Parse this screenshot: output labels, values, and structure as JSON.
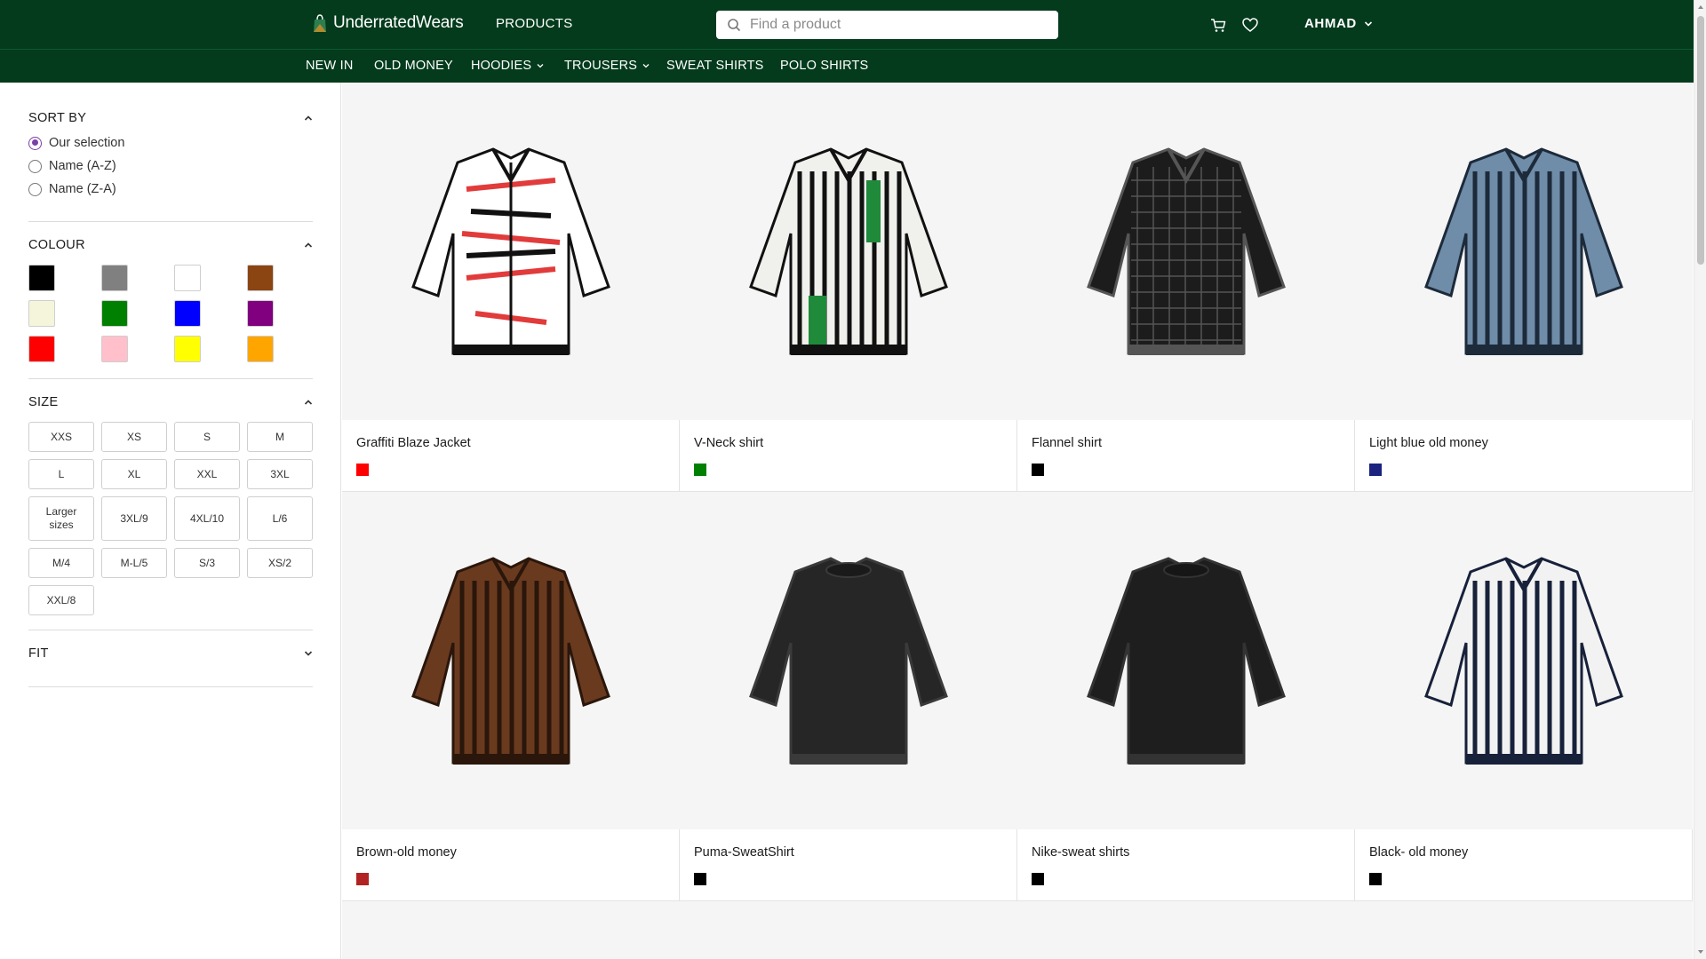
{
  "header": {
    "brand": "UnderratedWears",
    "products_label": "PRODUCTS",
    "search": {
      "placeholder": "Find a product",
      "value": ""
    },
    "user": "AHMAD",
    "icons": [
      "cart-icon",
      "heart-icon"
    ]
  },
  "categories": [
    {
      "label": "NEW IN",
      "dropdown": false
    },
    {
      "label": "OLD MONEY",
      "dropdown": false
    },
    {
      "label": "HOODIES",
      "dropdown": true
    },
    {
      "label": "TROUSERS",
      "dropdown": true
    },
    {
      "label": "SWEAT SHIRTS",
      "dropdown": false
    },
    {
      "label": "POLO SHIRTS",
      "dropdown": false
    }
  ],
  "sidebar": {
    "sort": {
      "title": "SORT BY",
      "options": [
        {
          "label": "Our selection",
          "selected": true
        },
        {
          "label": "Name (A-Z)",
          "selected": false
        },
        {
          "label": "Name (Z-A)",
          "selected": false
        }
      ]
    },
    "colour": {
      "title": "COLOUR",
      "swatches": [
        "#000000",
        "#808080",
        "#ffffff",
        "#8b4513",
        "#f5f5dc",
        "#008000",
        "#0000ff",
        "#800080",
        "#ff0000",
        "#ffc0cb",
        "#ffff00",
        "#ffa500"
      ]
    },
    "size": {
      "title": "SIZE",
      "options": [
        "XXS",
        "XS",
        "S",
        "M",
        "L",
        "XL",
        "XXL",
        "3XL",
        "Larger sizes",
        "3XL/9",
        "4XL/10",
        "L/6",
        "M/4",
        "M-L/5",
        "S/3",
        "XS/2",
        "XXL/8"
      ]
    },
    "fit": {
      "title": "FIT"
    }
  },
  "products": [
    {
      "name": "Graffiti Blaze Jacket",
      "color": "#ff0000",
      "icon": "hoodie-icon"
    },
    {
      "name": "V-Neck shirt",
      "color": "#008000",
      "icon": "shirt-icon"
    },
    {
      "name": "Flannel shirt",
      "color": "#000000",
      "icon": "shirt-icon"
    },
    {
      "name": "Light blue old money",
      "color": "#1a237e",
      "icon": "polo-icon"
    },
    {
      "name": "Brown-old money",
      "color": "#b22222",
      "icon": "polo-icon"
    },
    {
      "name": "Puma-SweatShirt",
      "color": "#000000",
      "icon": "sweatshirt-icon"
    },
    {
      "name": "Nike-sweat shirts",
      "color": "#000000",
      "icon": "sweatshirt-icon"
    },
    {
      "name": "Black- old money",
      "color": "#000000",
      "icon": "polo-icon"
    }
  ],
  "colors": {
    "header_bg": "#033b1c",
    "accent": "#7b3fa8"
  }
}
